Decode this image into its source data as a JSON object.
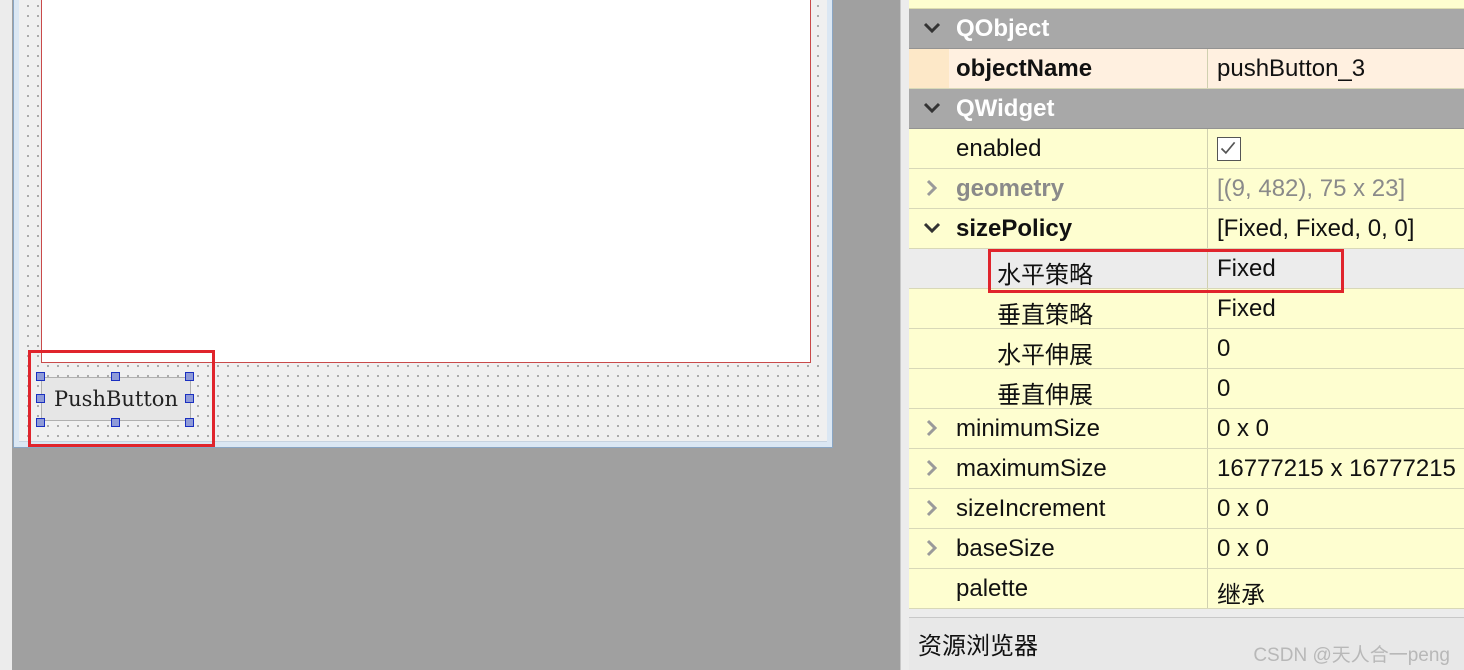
{
  "designer": {
    "push_button_label": "PushButton"
  },
  "property_editor": {
    "rows": [
      {
        "kind": "section",
        "name": "QObject"
      },
      {
        "kind": "prop",
        "name": "objectName",
        "value": "pushButton_3"
      },
      {
        "kind": "section",
        "name": "QWidget"
      },
      {
        "kind": "prop",
        "name": "enabled",
        "value": "checked"
      },
      {
        "kind": "prop",
        "name": "geometry",
        "value": "[(9, 482), 75 x 23]"
      },
      {
        "kind": "prop",
        "name": "sizePolicy",
        "value": "[Fixed, Fixed, 0, 0]"
      },
      {
        "kind": "sub",
        "name": "水平策略",
        "value": "Fixed"
      },
      {
        "kind": "sub",
        "name": "垂直策略",
        "value": "Fixed"
      },
      {
        "kind": "sub",
        "name": "水平伸展",
        "value": "0"
      },
      {
        "kind": "sub",
        "name": "垂直伸展",
        "value": "0"
      },
      {
        "kind": "prop",
        "name": "minimumSize",
        "value": "0 x 0"
      },
      {
        "kind": "prop",
        "name": "maximumSize",
        "value": "16777215 x 16777215"
      },
      {
        "kind": "prop",
        "name": "sizeIncrement",
        "value": "0 x 0"
      },
      {
        "kind": "prop",
        "name": "baseSize",
        "value": "0 x 0"
      },
      {
        "kind": "prop",
        "name": "palette",
        "value": "继承"
      }
    ]
  },
  "resource_browser": {
    "title": "资源浏览器"
  },
  "watermark": "CSDN @天人合一peng",
  "colors": {
    "highlight_red": "#e0242c",
    "section_gray": "#a8a8a8",
    "row_yellow": "#fefed0",
    "selection_handle": "#1a2fc0"
  }
}
